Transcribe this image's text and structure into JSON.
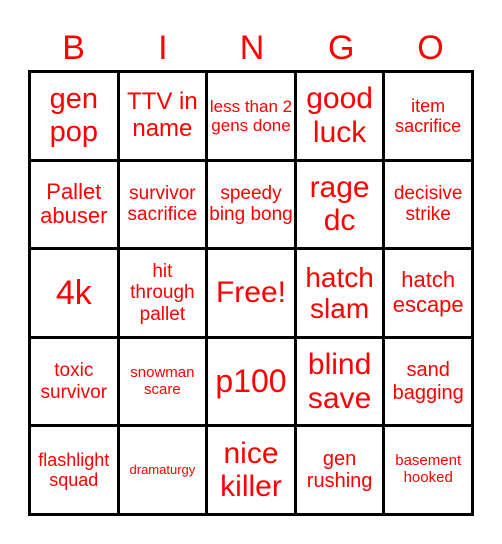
{
  "header": [
    "B",
    "I",
    "N",
    "G",
    "O"
  ],
  "accent_color": "#ff0000",
  "cells": [
    "gen pop",
    "TTV in name",
    "less than 2 gens done",
    "good luck",
    "item sacrifice",
    "Pallet abuser",
    "survivor sacrifice",
    "speedy bing bong",
    "rage dc",
    "decisive strike",
    "4k",
    "hit through pallet",
    "Free!",
    "hatch slam",
    "hatch escape",
    "toxic survivor",
    "snowman scare",
    "p100",
    "blind save",
    "sand bagging",
    "flashlight squad",
    "dramaturgy",
    "nice killer",
    "gen rushing",
    "basement hooked"
  ]
}
